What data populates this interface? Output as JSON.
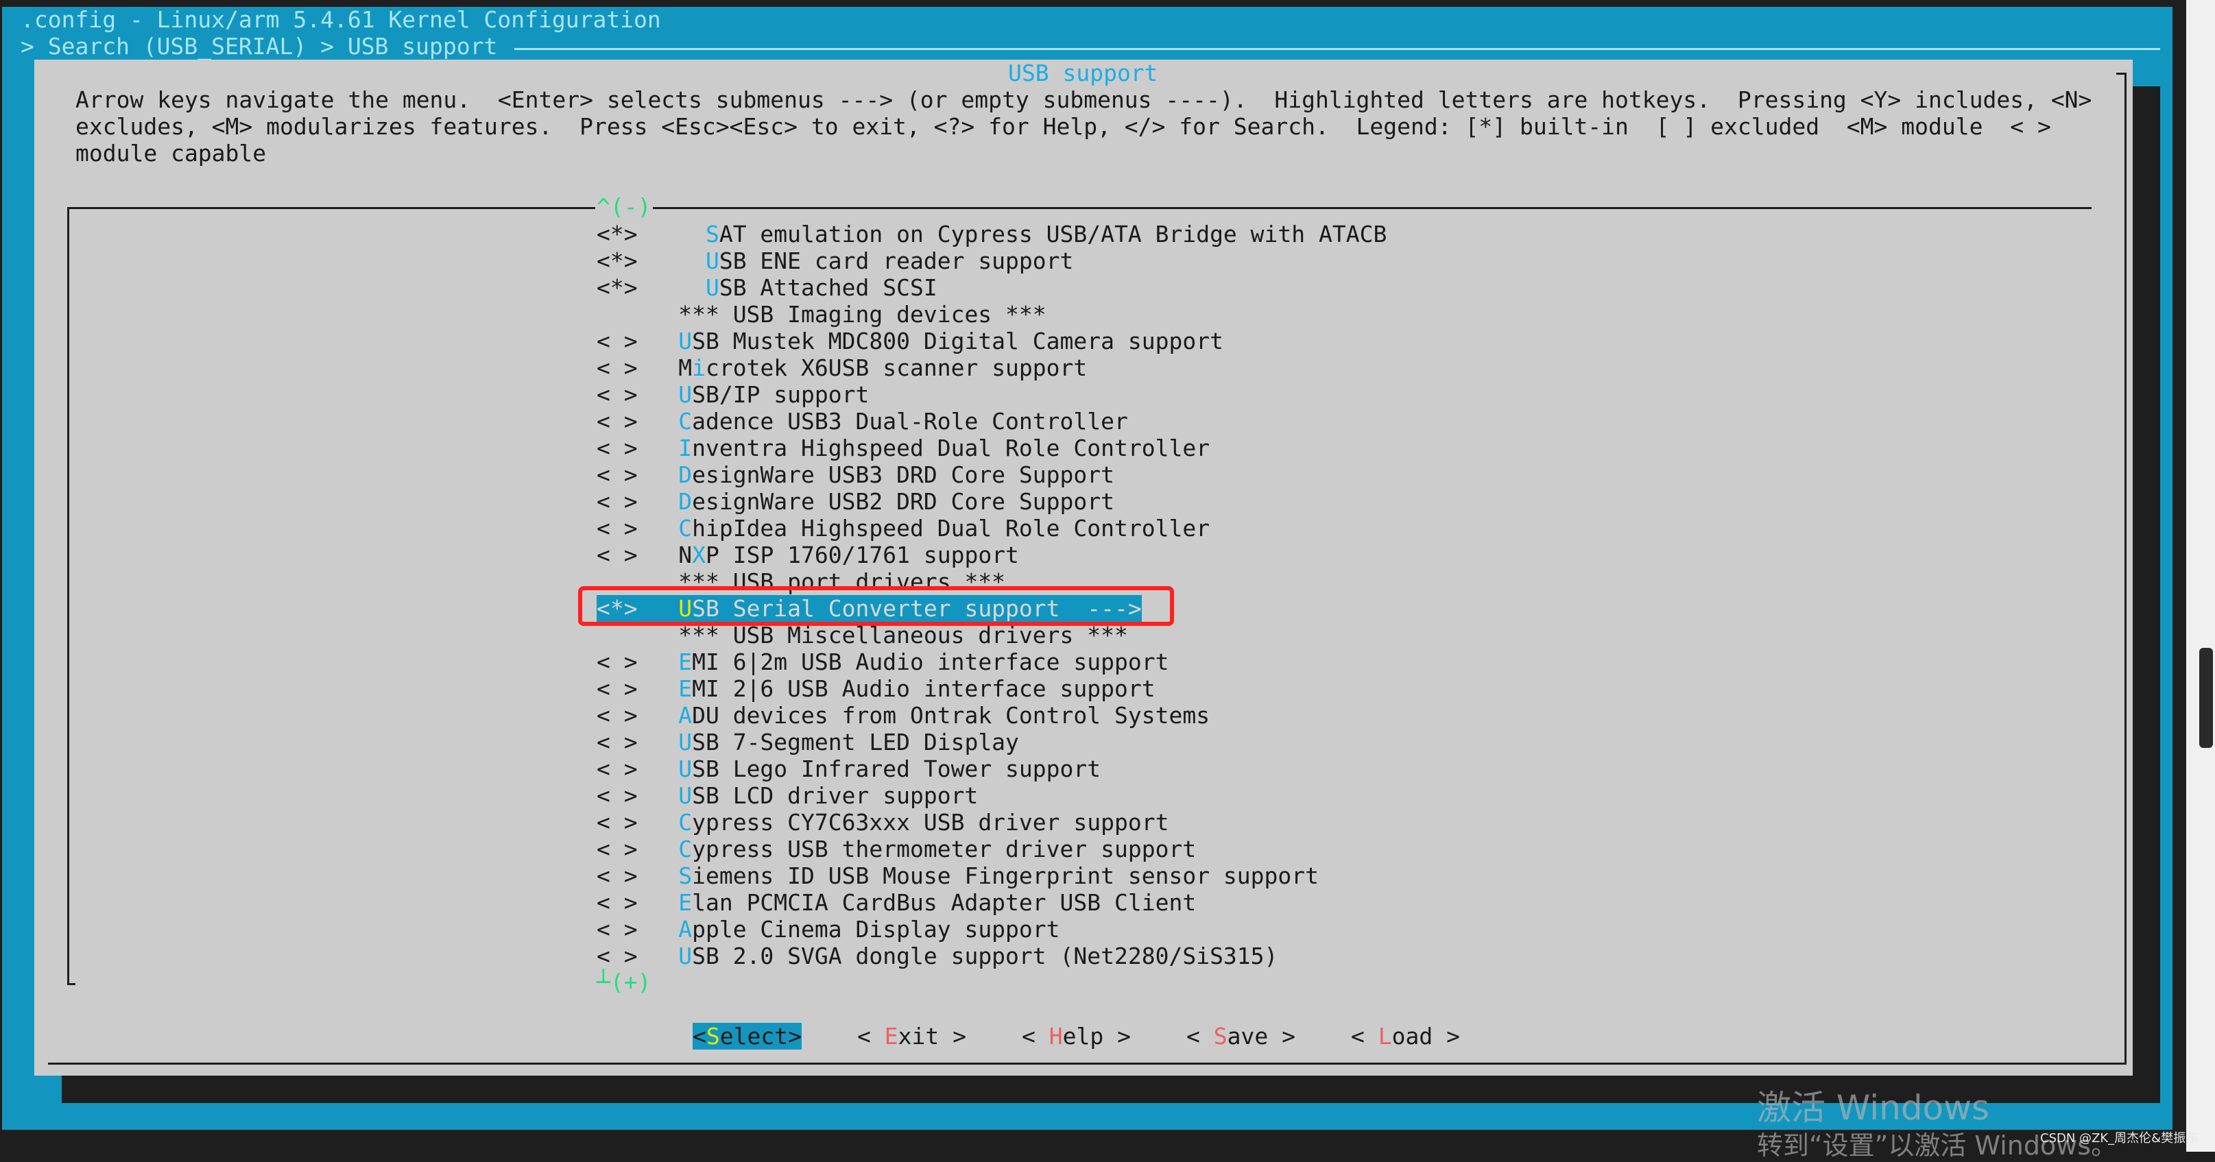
{
  "window": {
    "title": ".config - Linux/arm 5.4.61 Kernel Configuration",
    "breadcrumb": "> Search (USB_SERIAL) > USB support"
  },
  "dialog": {
    "title": "USB support",
    "help_lines": [
      "Arrow keys navigate the menu.  <Enter> selects submenus ---> (or empty submenus ----).  Highlighted letters are hotkeys.  Pressing <Y> includes, <N>",
      "excludes, <M> modularizes features.  Press <Esc><Esc> to exit, <?> for Help, </> for Search.  Legend: [*] built-in  [ ] excluded  <M> module  < >",
      "module capable"
    ],
    "scroll_up_indicator": "^(-)",
    "scroll_down_indicator": "┴(+)"
  },
  "menu": {
    "selected_index": 14,
    "items": [
      {
        "prefix": "<*>",
        "indent": 2,
        "text": "SAT emulation on Cypress USB/ATA Bridge with ATACB",
        "hotkey": 0
      },
      {
        "prefix": "<*>",
        "indent": 2,
        "text": "USB ENE card reader support",
        "hotkey": 0
      },
      {
        "prefix": "<*>",
        "indent": 2,
        "text": "USB Attached SCSI",
        "hotkey": 0
      },
      {
        "prefix": "",
        "indent": 0,
        "text": "*** USB Imaging devices ***",
        "hotkey": -1
      },
      {
        "prefix": "< >",
        "indent": 0,
        "text": "USB Mustek MDC800 Digital Camera support",
        "hotkey": 0
      },
      {
        "prefix": "< >",
        "indent": 0,
        "text": "Microtek X6USB scanner support",
        "hotkey": 1
      },
      {
        "prefix": "< >",
        "indent": 0,
        "text": "USB/IP support",
        "hotkey": 0
      },
      {
        "prefix": "< >",
        "indent": 0,
        "text": "Cadence USB3 Dual-Role Controller",
        "hotkey": 0
      },
      {
        "prefix": "< >",
        "indent": 0,
        "text": "Inventra Highspeed Dual Role Controller",
        "hotkey": 0
      },
      {
        "prefix": "< >",
        "indent": 0,
        "text": "DesignWare USB3 DRD Core Support",
        "hotkey": 0
      },
      {
        "prefix": "< >",
        "indent": 0,
        "text": "DesignWare USB2 DRD Core Support",
        "hotkey": 0
      },
      {
        "prefix": "< >",
        "indent": 0,
        "text": "ChipIdea Highspeed Dual Role Controller",
        "hotkey": 0
      },
      {
        "prefix": "< >",
        "indent": 0,
        "text": "NXP ISP 1760/1761 support",
        "hotkey": 1
      },
      {
        "prefix": "",
        "indent": 0,
        "text": "*** USB port drivers ***",
        "hotkey": -1
      },
      {
        "prefix": "<*>",
        "indent": 0,
        "text": "USB Serial Converter support  --->",
        "hotkey": 0
      },
      {
        "prefix": "",
        "indent": 0,
        "text": "*** USB Miscellaneous drivers ***",
        "hotkey": -1
      },
      {
        "prefix": "< >",
        "indent": 0,
        "text": "EMI 6|2m USB Audio interface support",
        "hotkey": 0
      },
      {
        "prefix": "< >",
        "indent": 0,
        "text": "EMI 2|6 USB Audio interface support",
        "hotkey": 0
      },
      {
        "prefix": "< >",
        "indent": 0,
        "text": "ADU devices from Ontrak Control Systems",
        "hotkey": 0
      },
      {
        "prefix": "< >",
        "indent": 0,
        "text": "USB 7-Segment LED Display",
        "hotkey": 0
      },
      {
        "prefix": "< >",
        "indent": 0,
        "text": "USB Lego Infrared Tower support",
        "hotkey": 0
      },
      {
        "prefix": "< >",
        "indent": 0,
        "text": "USB LCD driver support",
        "hotkey": 0
      },
      {
        "prefix": "< >",
        "indent": 0,
        "text": "Cypress CY7C63xxx USB driver support",
        "hotkey": 0
      },
      {
        "prefix": "< >",
        "indent": 0,
        "text": "Cypress USB thermometer driver support",
        "hotkey": 0
      },
      {
        "prefix": "< >",
        "indent": 0,
        "text": "Siemens ID USB Mouse Fingerprint sensor support",
        "hotkey": 0
      },
      {
        "prefix": "< >",
        "indent": 0,
        "text": "Elan PCMCIA CardBus Adapter USB Client",
        "hotkey": 0
      },
      {
        "prefix": "< >",
        "indent": 0,
        "text": "Apple Cinema Display support",
        "hotkey": 0
      },
      {
        "prefix": "< >",
        "indent": 0,
        "text": "USB 2.0 SVGA dongle support (Net2280/SiS315)",
        "hotkey": 0
      }
    ]
  },
  "buttons": [
    {
      "label": "Select",
      "selected": true
    },
    {
      "label": "Exit",
      "selected": false
    },
    {
      "label": "Help",
      "selected": false
    },
    {
      "label": "Save",
      "selected": false
    },
    {
      "label": "Load",
      "selected": false
    }
  ],
  "watermark": {
    "line1": "激活 Windows",
    "line2": "转到“设置”以激活 Windows。",
    "credit": "CSDN @ZK_周杰伦&樊振东"
  },
  "colors": {
    "terminal_bg": "#1296bf",
    "dialog_bg": "#cccccc",
    "hotkey": "#1aaee6",
    "button_hotkey": "#f06060",
    "scroll_indicator": "#22e07a",
    "annotation_box": "#ff2020"
  }
}
